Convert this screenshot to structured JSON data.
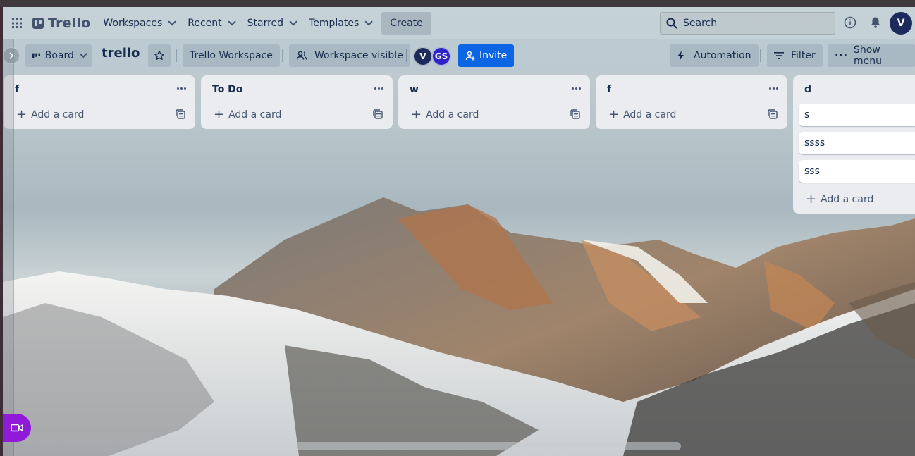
{
  "header": {
    "logo_text": "Trello",
    "nav": [
      {
        "label": "Workspaces"
      },
      {
        "label": "Recent"
      },
      {
        "label": "Starred"
      },
      {
        "label": "Templates"
      }
    ],
    "create_label": "Create",
    "search_placeholder": "Search",
    "avatar_initial": "V"
  },
  "boardbar": {
    "view_label": "Board",
    "board_title": "trello",
    "workspace_label": "Trello Workspace",
    "visibility_label": "Workspace visible",
    "members": [
      {
        "initials": "V",
        "color": "#1d2b5c"
      },
      {
        "initials": "GS",
        "color": "#2e23c9"
      }
    ],
    "invite_label": "Invite",
    "automation_label": "Automation",
    "filter_label": "Filter",
    "show_menu_label": "Show menu"
  },
  "lists": [
    {
      "title": "f",
      "add_label": "Add a card",
      "cards": []
    },
    {
      "title": "To Do",
      "add_label": "Add a card",
      "cards": []
    },
    {
      "title": "w",
      "add_label": "Add a card",
      "cards": []
    },
    {
      "title": "f",
      "add_label": "Add a card",
      "cards": []
    },
    {
      "title": "d",
      "add_label": "Add a card",
      "cards": [
        "s",
        "ssss",
        "sss"
      ]
    }
  ],
  "colors": {
    "accent": "#0c66e4",
    "video_button": "#8f1bd9",
    "list_bg": "#ebecf0"
  }
}
